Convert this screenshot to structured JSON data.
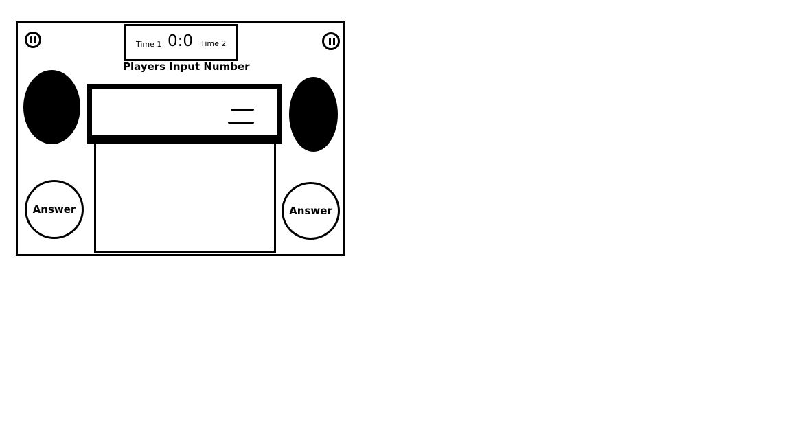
{
  "scoreboard": {
    "team_left": "Time 1",
    "score": "0:0",
    "team_right": "Time 2"
  },
  "prompt": "Players Input Number",
  "answer_left": "Answer",
  "answer_right": "Answer",
  "input": {
    "value": ""
  },
  "icons": {
    "left_corner": "pause-icon",
    "right_corner": "pause-icon",
    "input_menu": "menu-icon",
    "left_speaker": "speaker-icon",
    "right_speaker": "speaker-icon"
  }
}
